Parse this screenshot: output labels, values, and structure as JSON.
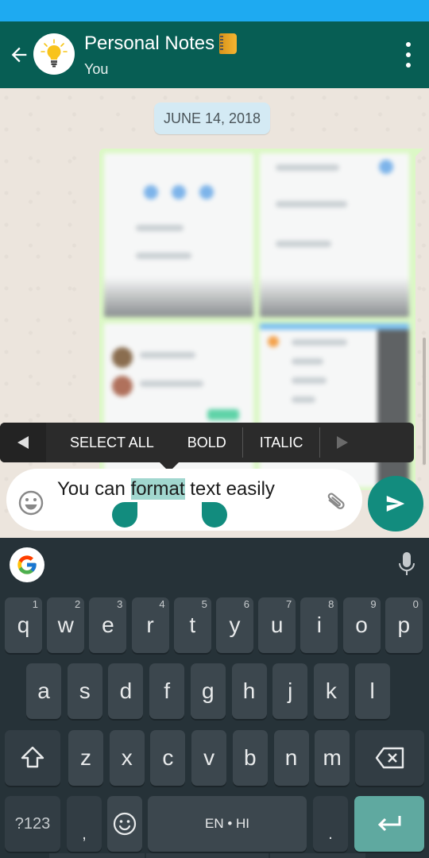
{
  "status_bar": {
    "color": "#1eaaf1"
  },
  "header": {
    "title": "Personal Notes",
    "title_emoji": "notebook-icon",
    "subtitle": "You",
    "avatar_icon": "lightbulb-icon",
    "back_icon": "arrow-left-icon",
    "menu_icon": "more-vertical-icon",
    "color": "#075e54"
  },
  "chat": {
    "date_chip": "JUNE 14, 2018",
    "messages": [
      {
        "type": "image",
        "outgoing": true,
        "description": "blurred collage of four app screenshots",
        "bubble_color": "#dcf8c6"
      }
    ]
  },
  "text_toolbar": {
    "prev_icon": "triangle-left-icon",
    "items": [
      "SELECT ALL",
      "BOLD",
      "ITALIC"
    ],
    "next_icon": "triangle-right-icon"
  },
  "composer": {
    "text_before": "You can ",
    "selected_text": "format",
    "text_after": " text easily",
    "emoji_icon": "smiley-icon",
    "attach_icon": "paperclip-icon",
    "send_icon": "send-icon",
    "accent": "#128c7e"
  },
  "keyboard": {
    "row1": [
      {
        "key": "q",
        "hint": "1"
      },
      {
        "key": "w",
        "hint": "2"
      },
      {
        "key": "e",
        "hint": "3"
      },
      {
        "key": "r",
        "hint": "4"
      },
      {
        "key": "t",
        "hint": "5"
      },
      {
        "key": "y",
        "hint": "6"
      },
      {
        "key": "u",
        "hint": "7"
      },
      {
        "key": "i",
        "hint": "8"
      },
      {
        "key": "o",
        "hint": "9"
      },
      {
        "key": "p",
        "hint": "0"
      }
    ],
    "row2": [
      "a",
      "s",
      "d",
      "f",
      "g",
      "h",
      "j",
      "k",
      "l"
    ],
    "row3": [
      "z",
      "x",
      "c",
      "v",
      "b",
      "n",
      "m"
    ],
    "symbols_label": "?123",
    "comma": ",",
    "space_label": "EN • HI",
    "period": ".",
    "shift_icon": "shift-icon",
    "backspace_icon": "backspace-icon",
    "emoji_icon": "smiley-icon",
    "enter_icon": "enter-icon",
    "google_icon": "google-g-icon",
    "mic_icon": "microphone-icon"
  }
}
